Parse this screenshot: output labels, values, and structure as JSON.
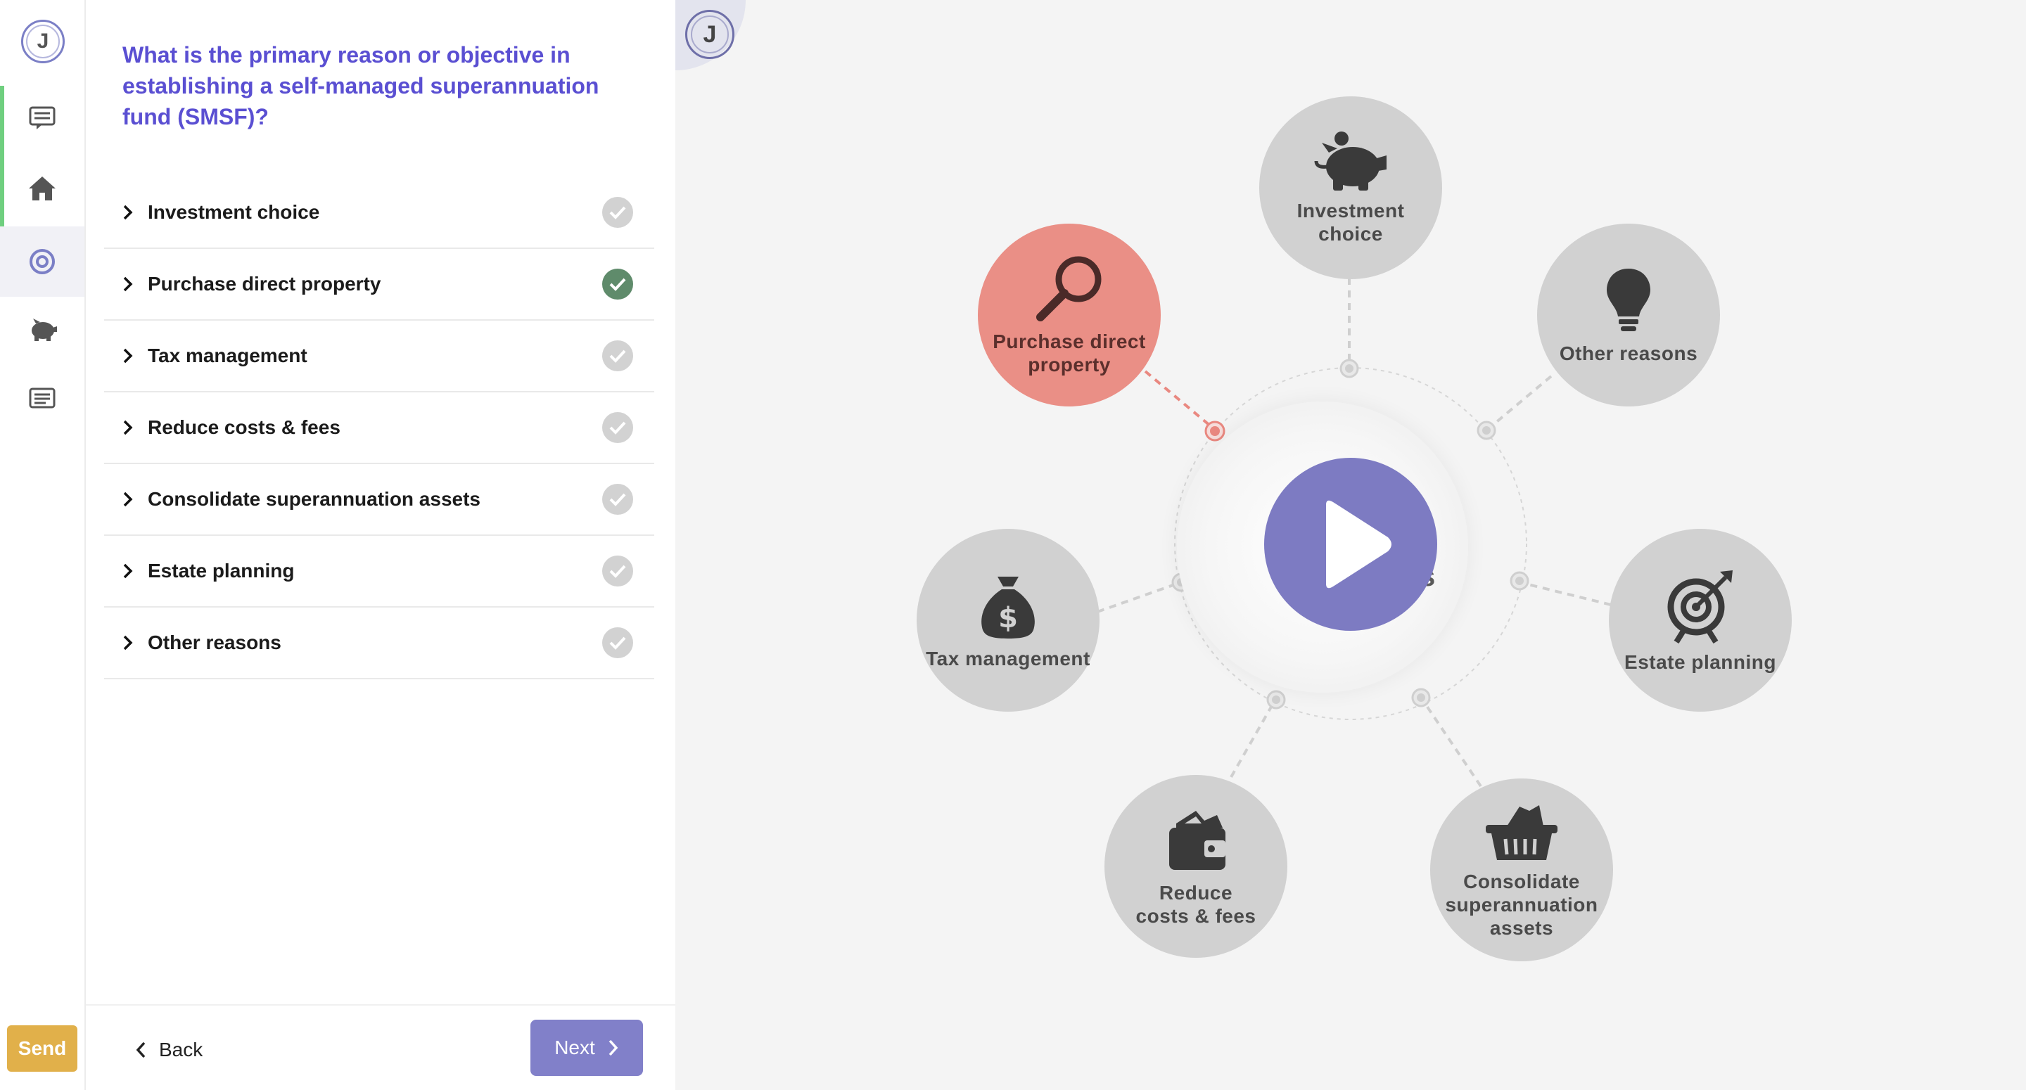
{
  "app": {
    "logo_letter": "J"
  },
  "rail": {
    "items": [
      {
        "name": "rail-item-chat",
        "icon": "chat-icon",
        "bar_color": "#6fcf7f"
      },
      {
        "name": "rail-item-home",
        "icon": "home-icon",
        "bar_color": "#6fcf7f"
      },
      {
        "name": "rail-item-goals",
        "icon": "target-icon",
        "bar_color": "#e8b64c",
        "active": true
      },
      {
        "name": "rail-item-savings",
        "icon": "piggy-bank-icon"
      },
      {
        "name": "rail-item-notes",
        "icon": "list-icon"
      }
    ],
    "send_label": "Send"
  },
  "question": {
    "text": "What is the primary reason or objective in establishing a self-managed superannuation fund (SMSF)?"
  },
  "options": [
    {
      "label": "Investment choice",
      "checked": false
    },
    {
      "label": "Purchase direct property",
      "checked": true
    },
    {
      "label": "Tax management",
      "checked": false
    },
    {
      "label": "Reduce costs & fees",
      "checked": false
    },
    {
      "label": "Consolidate superannuation assets",
      "checked": false
    },
    {
      "label": "Estate planning",
      "checked": false
    },
    {
      "label": "Other reasons",
      "checked": false
    }
  ],
  "footer": {
    "back_label": "Back",
    "next_label": "Next"
  },
  "diagram": {
    "hub_ghost_text": "s",
    "nodes": [
      {
        "key": "investment",
        "label_lines": [
          "Investment",
          "choice"
        ],
        "icon": "piggy-bank-icon"
      },
      {
        "key": "property",
        "label_lines": [
          "Purchase direct",
          "property"
        ],
        "icon": "magnifier-icon",
        "selected": true
      },
      {
        "key": "other",
        "label_lines": [
          "Other reasons"
        ],
        "icon": "lightbulb-icon"
      },
      {
        "key": "tax",
        "label_lines": [
          "Tax management"
        ],
        "icon": "money-bag-icon"
      },
      {
        "key": "estate",
        "label_lines": [
          "Estate planning"
        ],
        "icon": "target-arrow-icon"
      },
      {
        "key": "costs",
        "label_lines": [
          "Reduce",
          "costs & fees"
        ],
        "icon": "wallet-icon"
      },
      {
        "key": "consolidate",
        "label_lines": [
          "Consolidate",
          "superannuation",
          "assets"
        ],
        "icon": "basket-icon"
      }
    ]
  },
  "colors": {
    "accent": "#5a4fd2",
    "button": "#8180c9",
    "selected_node": "#ea8f86",
    "check_on": "#5f8b6b",
    "send": "#e1b04a"
  }
}
